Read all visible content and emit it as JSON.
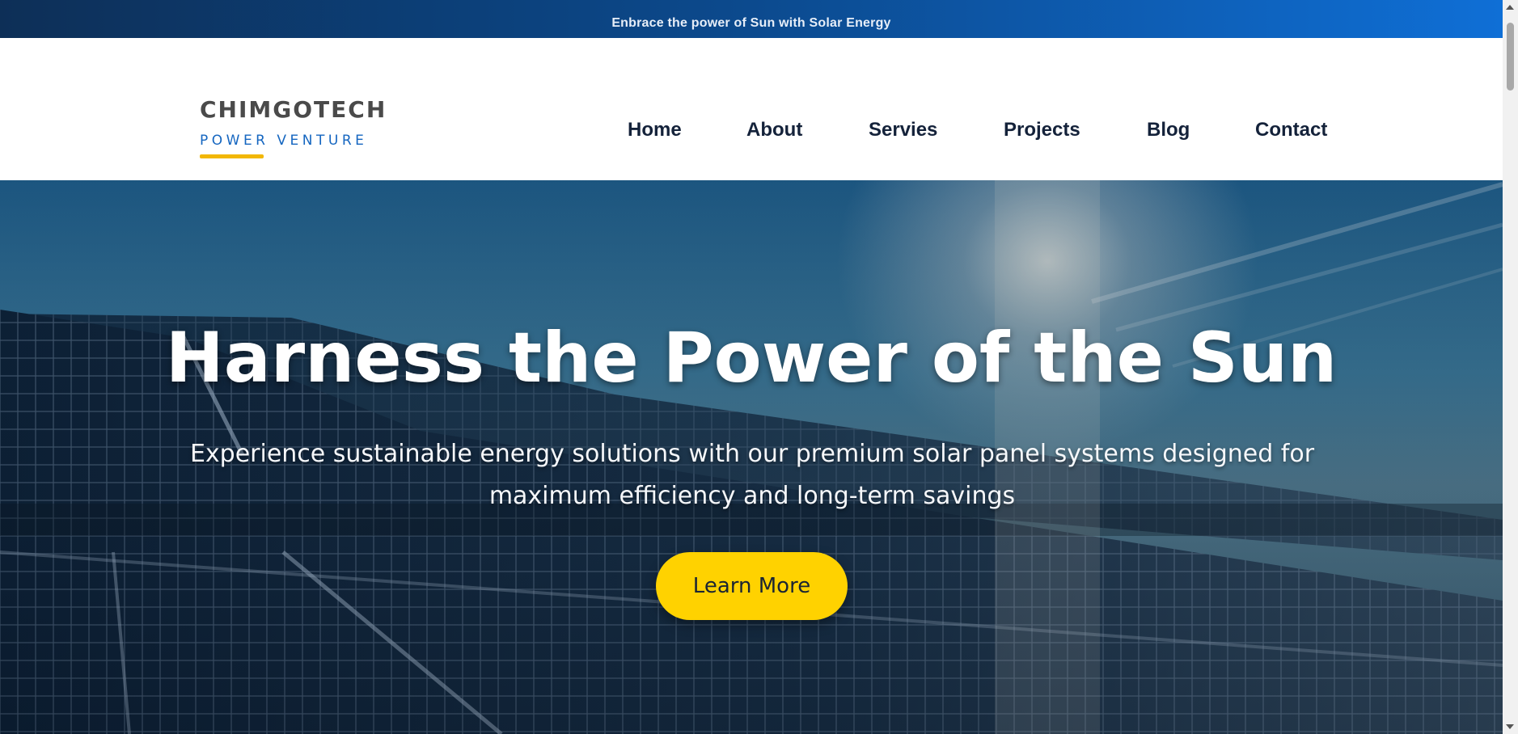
{
  "topbar": {
    "text": "Enbrace the power of Sun with Solar Energy"
  },
  "logo": {
    "name": "CHIMGOTECH",
    "tagline": "POWER VENTURE"
  },
  "nav": {
    "items": [
      {
        "label": "Home"
      },
      {
        "label": "About"
      },
      {
        "label": "Servies"
      },
      {
        "label": "Projects"
      },
      {
        "label": "Blog"
      },
      {
        "label": "Contact"
      }
    ]
  },
  "hero": {
    "title": "Harness the Power of the Sun",
    "subtitle": "Experience sustainable energy solutions with our premium solar panel systems designed for maximum efficiency and long-term savings",
    "cta_label": "Learn More"
  },
  "colors": {
    "accent_yellow": "#ffd200",
    "brand_blue": "#1566c0",
    "nav_text": "#14223a"
  }
}
